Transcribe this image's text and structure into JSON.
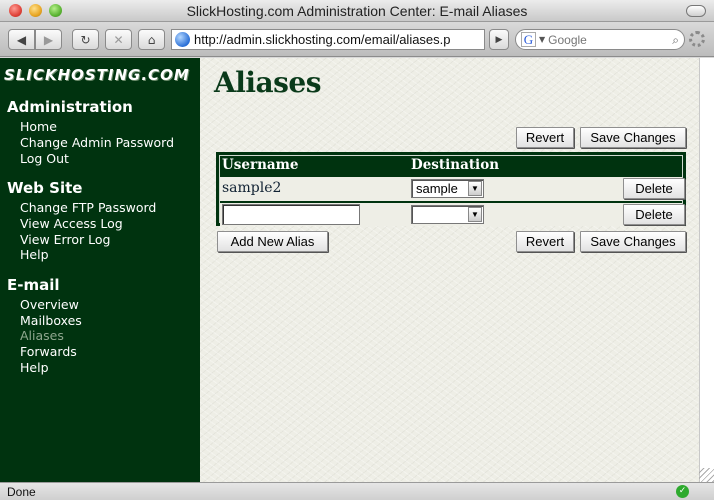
{
  "window": {
    "title": "SlickHosting.com Administration Center: E-mail Aliases"
  },
  "toolbar": {
    "url": "http://admin.slickhosting.com/email/aliases.p",
    "search_placeholder": "Google"
  },
  "sidebar": {
    "logo": "SLICKHOSTING.COM",
    "sections": [
      {
        "heading": "Administration",
        "links": [
          "Home",
          "Change Admin Password",
          "Log Out"
        ]
      },
      {
        "heading": "Web Site",
        "links": [
          "Change FTP Password",
          "View Access Log",
          "View Error Log",
          "Help"
        ]
      },
      {
        "heading": "E-mail",
        "links": [
          "Overview",
          "Mailboxes",
          "Aliases",
          "Forwards",
          "Help"
        ]
      }
    ],
    "current_link": "Aliases"
  },
  "main": {
    "title": "Aliases",
    "revert_label": "Revert",
    "save_label": "Save Changes",
    "add_alias_label": "Add New Alias",
    "table": {
      "headers": [
        "Username",
        "Destination"
      ],
      "rows": [
        {
          "username": "sample2",
          "destination": "sample",
          "delete_label": "Delete"
        },
        {
          "username": "",
          "destination": "",
          "delete_label": "Delete"
        }
      ]
    }
  },
  "status": {
    "text": "Done",
    "secure_icon": "check-circle-icon",
    "accent_color": "#00330f"
  }
}
